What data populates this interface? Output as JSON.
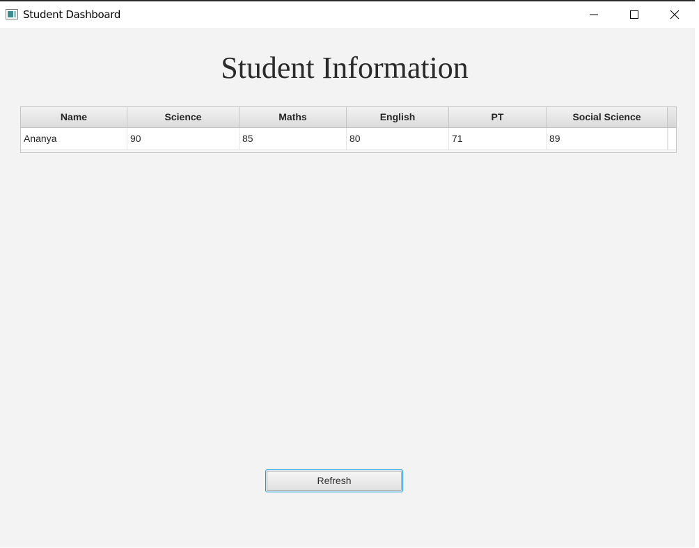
{
  "window": {
    "title": "Student Dashboard",
    "icons": {
      "app": "app-icon",
      "minimize": "minimize-icon",
      "maximize": "maximize-icon",
      "close": "close-icon"
    }
  },
  "page": {
    "heading": "Student Information"
  },
  "table": {
    "columns": [
      "Name",
      "Science",
      "Maths",
      "English",
      "PT",
      "Social Science"
    ],
    "rows": [
      [
        "Ananya",
        "90",
        "85",
        "80",
        "71",
        "89"
      ]
    ]
  },
  "actions": {
    "refresh_label": "Refresh"
  },
  "colors": {
    "background": "#f3f3f3",
    "focus_border": "#1a9be0",
    "header_gradient_top": "#f2f2f2",
    "header_gradient_bottom": "#dcdcdc"
  }
}
